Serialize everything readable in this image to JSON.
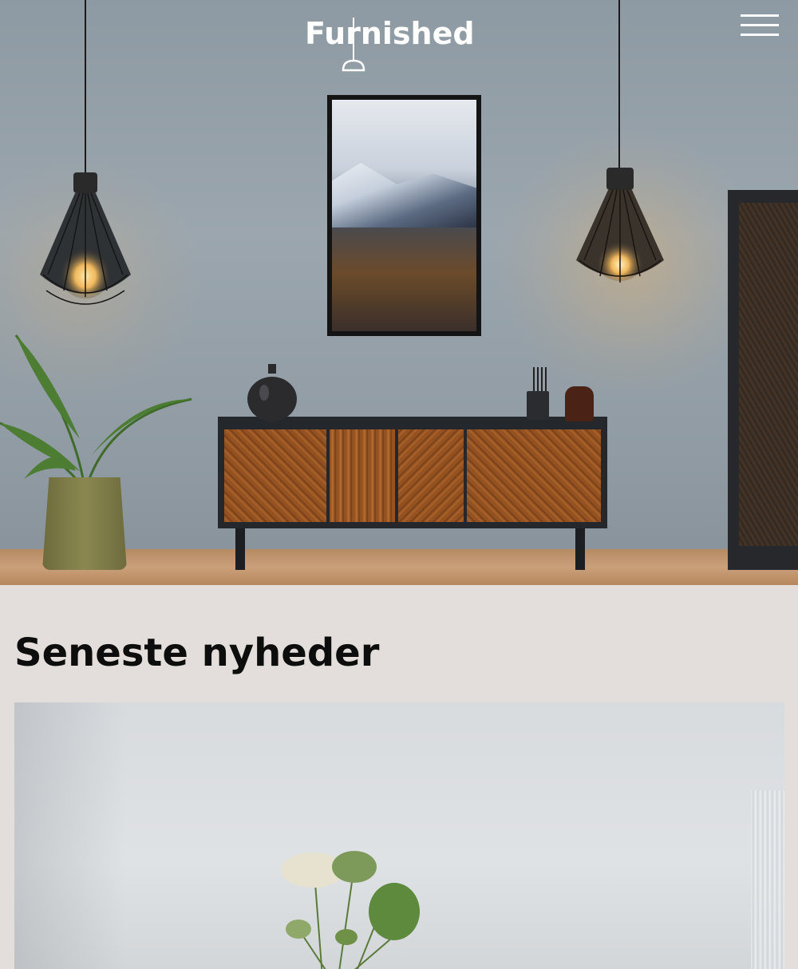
{
  "header": {
    "logo_text": "Furnished",
    "menu_icon": "hamburger-menu-icon",
    "logo_color": "#ffffff"
  },
  "hero": {
    "image": "living-room-sideboard-photo"
  },
  "news": {
    "title": "Seneste nyheder",
    "cards": [
      {
        "image": "flower-vase-photo"
      }
    ]
  },
  "colors": {
    "page_background": "#e3dedb",
    "heading": "#0d0d0d"
  }
}
